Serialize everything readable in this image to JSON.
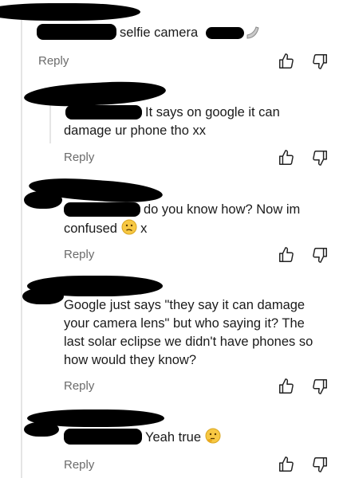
{
  "comments": [
    {
      "text": "selfie camera",
      "reply": "Reply"
    },
    {
      "text_line1": "It says on google it can",
      "text_line2": "damage ur phone tho xx",
      "reply": "Reply"
    },
    {
      "text_line1": "do you know how? Now im",
      "text_line2_a": "confused",
      "text_line2_b": "x",
      "reply": "Reply"
    },
    {
      "lines": [
        "Google just says \"they say it can damage",
        "your camera lens\" but who saying it? The",
        "last solar eclipse we didn't have phones so",
        "how would they know?"
      ],
      "reply": "Reply"
    },
    {
      "text": "Yeah true",
      "reply": "Reply"
    }
  ],
  "icons": {
    "like": "thumbs-up-icon",
    "dislike": "thumbs-down-icon"
  },
  "colors": {
    "text": "#1a1a1a",
    "muted": "#6b6b6b",
    "thread": "#e5e5e5"
  }
}
